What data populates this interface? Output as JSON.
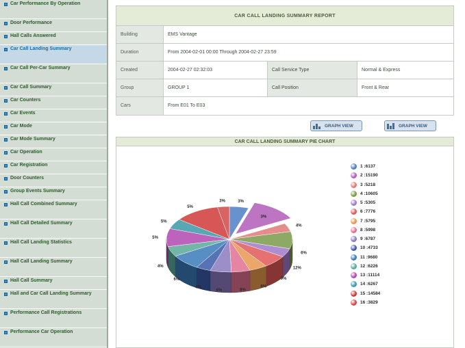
{
  "sidebar": {
    "items": [
      {
        "label": "Car Performance By Operation",
        "active": false
      },
      {
        "label": "Door Performance",
        "active": false
      },
      {
        "label": "Hall Calls Answered",
        "active": false
      },
      {
        "label": "Car Call Landing Summary",
        "active": true
      },
      {
        "label": "Car Call Per-Car Summary",
        "active": false
      },
      {
        "label": "Car Call Summary",
        "active": false
      },
      {
        "label": "Car Counters",
        "active": false
      },
      {
        "label": "Car Events",
        "active": false
      },
      {
        "label": "Car Mode",
        "active": false
      },
      {
        "label": "Car Mode Summary",
        "active": false
      },
      {
        "label": "Car Operation",
        "active": false
      },
      {
        "label": "Car Registration",
        "active": false
      },
      {
        "label": "Door Counters",
        "active": false
      },
      {
        "label": "Group Events Summary",
        "active": false
      },
      {
        "label": "Hall Call Combined Summary",
        "active": false
      },
      {
        "label": "Hall Call Detailed Summary",
        "active": false
      },
      {
        "label": "Hall Call Landing Statistics",
        "active": false
      },
      {
        "label": "Hall Call Landing Summary",
        "active": false
      },
      {
        "label": "Hall Call Summary",
        "active": false
      },
      {
        "label": "Hall and Car Call Landing Summary",
        "active": false
      },
      {
        "label": "Performance Call Registrations",
        "active": false
      },
      {
        "label": "Performance Car Operation",
        "active": false
      },
      {
        "label": "Performance Car Timing",
        "active": false
      }
    ]
  },
  "report": {
    "title": "CAR CALL LANDING SUMMARY REPORT",
    "building_label": "Building",
    "building_value": "EMS Vantage",
    "duration_label": "Duration",
    "duration_value": "From 2004-02-01 00:00 Through 2004-02-27 23:59",
    "created_label": "Created",
    "created_value": "2004-02-27 02:32:03",
    "call_service_type_label": "Call Service Type",
    "call_service_type_value": "Normal & Express",
    "group_label": "Group",
    "group_value": "GROUP 1",
    "call_position_label": "Call Position",
    "call_position_value": "Front & Rear",
    "cars_label": "Cars",
    "cars_value": "From E01 To E03"
  },
  "buttons": {
    "graph_view_1": "GRAPH VIEW",
    "graph_view_2": "GRAPH VIEW"
  },
  "chart_data": {
    "type": "pie",
    "title": "CAR CALL LANDING SUMMARY PIE CHART",
    "slice_labels": [
      "3%",
      "3%",
      "4%",
      "6%",
      "12%",
      "9%",
      "8%",
      "8%",
      "6%",
      "6%",
      "6%",
      "4%",
      "5%",
      "5%",
      "5%",
      "3%"
    ],
    "series": [
      {
        "category": "1",
        "value": 6137,
        "color": "#4e7fc4"
      },
      {
        "category": "2",
        "value": 15190,
        "color": "#b05cb8"
      },
      {
        "category": "3",
        "value": 5218,
        "color": "#e07878"
      },
      {
        "category": "4",
        "value": 10605,
        "color": "#7a9a4a"
      },
      {
        "category": "5",
        "value": 5305,
        "color": "#a07ac8"
      },
      {
        "category": "6",
        "value": 7776,
        "color": "#e05858"
      },
      {
        "category": "7",
        "value": 5795,
        "color": "#e89850"
      },
      {
        "category": "8",
        "value": 5998,
        "color": "#e07090"
      },
      {
        "category": "9",
        "value": 6787,
        "color": "#8a7ac0"
      },
      {
        "category": "10",
        "value": 4733,
        "color": "#3a5aa8"
      },
      {
        "category": "11",
        "value": 9680,
        "color": "#3a7ab8"
      },
      {
        "category": "12",
        "value": 6226,
        "color": "#5aa898"
      },
      {
        "category": "13",
        "value": 11114,
        "color": "#b048b0"
      },
      {
        "category": "14",
        "value": 6267,
        "color": "#3a98a8"
      },
      {
        "category": "15",
        "value": 14584,
        "color": "#d03838"
      },
      {
        "category": "16",
        "value": 3829,
        "color": "#d04848"
      }
    ]
  }
}
